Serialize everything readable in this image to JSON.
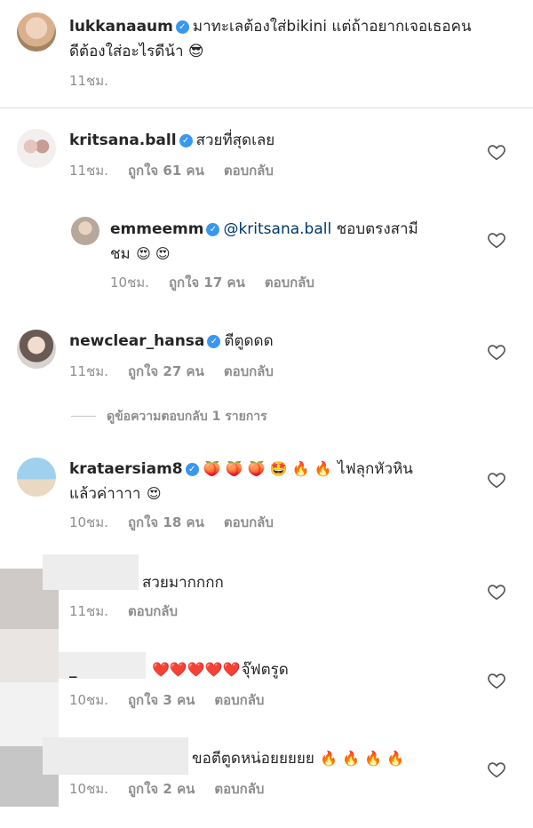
{
  "post": {
    "username": "lukkanaaum",
    "caption_line1": "มาทะเลต้องใส่bikini แต่ถ้าอยากเจอเธอคน",
    "caption_line2": "ดีต้องใส่อะไรดีน้า",
    "caption_emoji": "😎",
    "time": "11ชม."
  },
  "comments": [
    {
      "username": "kritsana.ball",
      "text": "สวยที่สุดเลย",
      "time": "11ชม.",
      "likes": "ถูกใจ 61 คน",
      "reply": "ตอบกลับ"
    },
    {
      "username": "emmeemm",
      "mention": "@kritsana.ball",
      "text": " ชอบตรงสามี",
      "text2": "ชม",
      "emoji": "😍 😍",
      "time": "10ชม.",
      "likes": "ถูกใจ 17 คน",
      "reply": "ตอบกลับ"
    },
    {
      "username": "newclear_hansa",
      "text": "ตีตูดดด",
      "time": "11ชม.",
      "likes": "ถูกใจ 27 คน",
      "reply": "ตอบกลับ"
    },
    {
      "username": "krataersiam8",
      "emoji": "🍑 🍑 🍑 🤩 🔥 🔥",
      "text": "ไฟลุกหัวหิน",
      "text2": "แล้วค่าาาา",
      "emoji2": "😍",
      "time": "10ชม.",
      "likes": "ถูกใจ 18 คน",
      "reply": "ตอบกลับ"
    },
    {
      "username_partial": "",
      "text": "สวยมากกกก",
      "time": "11ชม.",
      "reply": "ตอบกลับ"
    },
    {
      "username_partial": "_",
      "emoji": "❤️❤️❤️❤️❤️",
      "text": "จุ๊ฟตรูด",
      "time": "10ชม.",
      "likes": "ถูกใจ 3 คน",
      "reply": "ตอบกลับ"
    },
    {
      "text": "ขอตีตูดหน่อยยยยย",
      "emoji": "🔥 🔥 🔥 🔥",
      "time": "10ชม.",
      "likes": "ถูกใจ 2 คน",
      "reply": "ตอบกลับ"
    }
  ],
  "view_replies": "ดูข้อความตอบกลับ 1 รายการ",
  "icons": {
    "verified": "verified-badge-icon",
    "like": "heart-outline-icon"
  },
  "colors": {
    "verified": "#3897f0",
    "mention": "#00376b",
    "meta": "#8e8e8e"
  }
}
